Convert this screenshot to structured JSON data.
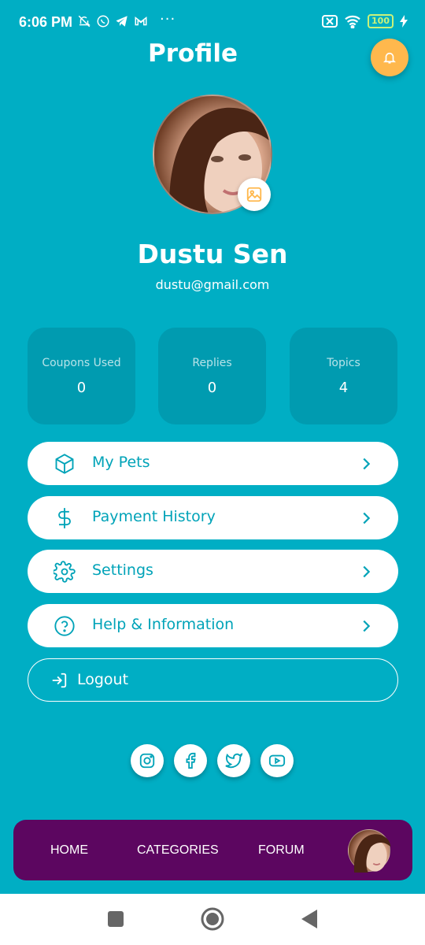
{
  "status_bar": {
    "time": "6:06 PM",
    "dots": "···",
    "battery": "100"
  },
  "header": {
    "title": "Profile",
    "bell_icon": "bell-icon"
  },
  "profile": {
    "name": "Dustu Sen",
    "email": "dustu@gmail.com",
    "edit_icon": "image-icon"
  },
  "stats": [
    {
      "label": "Coupons Used",
      "value": "0"
    },
    {
      "label": "Replies",
      "value": "0"
    },
    {
      "label": "Topics",
      "value": "4"
    }
  ],
  "menu": [
    {
      "label": "My Pets",
      "icon": "box-icon"
    },
    {
      "label": "Payment History",
      "icon": "dollar-icon"
    },
    {
      "label": "Settings",
      "icon": "gear-icon"
    },
    {
      "label": "Help & Information",
      "icon": "help-icon"
    }
  ],
  "logout": {
    "label": "Logout",
    "icon": "logout-icon"
  },
  "social": [
    "instagram-icon",
    "facebook-icon",
    "twitter-icon",
    "youtube-icon"
  ],
  "bottom_nav": {
    "items": [
      "HOME",
      "CATEGORIES",
      "FORUM"
    ]
  },
  "colors": {
    "background": "#00AEC4",
    "stat_card": "#009BB0",
    "accent_text": "#00A3B8",
    "bell": "#FFB84D",
    "bottom_nav": "#5C0660"
  }
}
